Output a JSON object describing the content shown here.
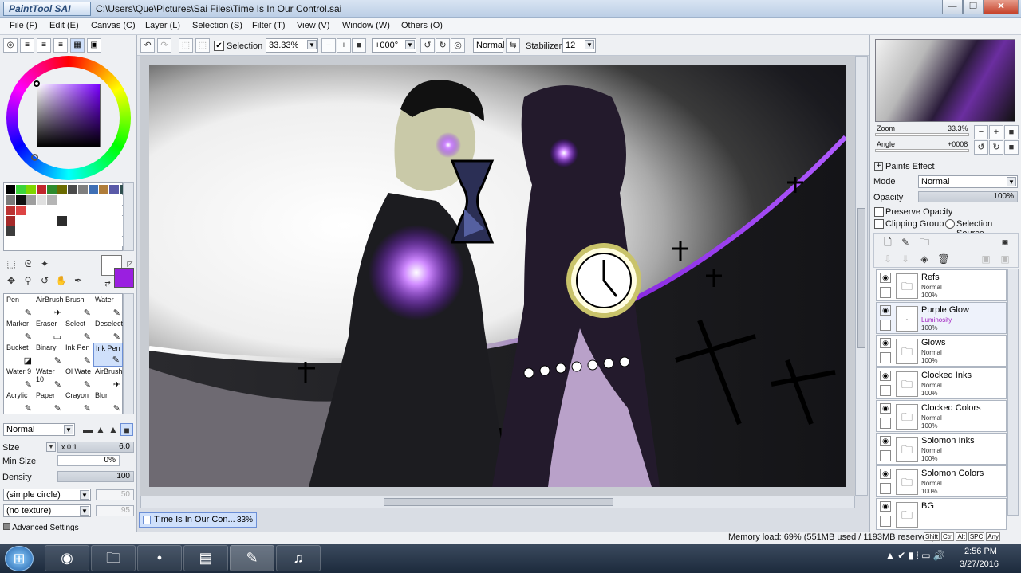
{
  "window": {
    "app_name": "PaintTool SAI",
    "title": "C:\\Users\\Que\\Pictures\\Sai Files\\Time Is In Our Control.sai",
    "controls": [
      "—",
      "❐",
      "✕"
    ]
  },
  "menu": [
    "File (F)",
    "Edit (E)",
    "Canvas (C)",
    "Layer (L)",
    "Selection (S)",
    "Filter (T)",
    "View (V)",
    "Window (W)",
    "Others (O)"
  ],
  "color_panel": {
    "foreground": "#ffffff",
    "background": "#9a1fe0",
    "hue_accent": "#7a00ff"
  },
  "swatches": [
    "#000",
    "#3bd43b",
    "#7fd600",
    "#c1272d",
    "#2e8b2e",
    "#6b6b00",
    "#4a4a4a",
    "#7f7f7f",
    "#3f6fb5",
    "#b07d3a",
    "#5a5aa8",
    "#2f4f4f",
    "#7a7a7a",
    "#111",
    "#9e9e9e",
    "#e0e0e0",
    "#b5b5b5",
    "#ffffff",
    "#ffffff",
    "#ffffff",
    "#ffffff",
    "#ffffff",
    "#ffffff",
    "#ffffff",
    "#b33",
    "#dd4444",
    "#ffffff",
    "#ffffff",
    "#ffffff",
    "#ffffff",
    "#ffffff",
    "#ffffff",
    "#ffffff",
    "#ffffff",
    "#ffffff",
    "#ffffff",
    "#a52a2a",
    "#ffffff",
    "#ffffff",
    "#ffffff",
    "#ffffff",
    "#2d2d2d",
    "#ffffff",
    "#ffffff",
    "#ffffff",
    "#ffffff",
    "#ffffff",
    "#ffffff",
    "#3d3d3d",
    "#ffffff",
    "#ffffff",
    "#ffffff",
    "#ffffff",
    "#ffffff",
    "#ffffff",
    "#ffffff",
    "#ffffff",
    "#ffffff",
    "#ffffff",
    "#ffffff",
    "#ffffff",
    "#ffffff",
    "#ffffff",
    "#ffffff",
    "#ffffff",
    "#ffffff",
    "#ffffff",
    "#ffffff",
    "#ffffff",
    "#ffffff",
    "#ffffff",
    "#ffffff"
  ],
  "brushes": [
    {
      "name": "Pen",
      "icon": "✎"
    },
    {
      "name": "AirBrush",
      "icon": "✈"
    },
    {
      "name": "Brush",
      "icon": "✎"
    },
    {
      "name": "Water",
      "icon": "✎"
    },
    {
      "name": "Marker",
      "icon": "✎"
    },
    {
      "name": "Eraser",
      "icon": "▭"
    },
    {
      "name": "Select",
      "icon": "✎"
    },
    {
      "name": "Deselect",
      "icon": "✎"
    },
    {
      "name": "Bucket",
      "icon": "◪"
    },
    {
      "name": "Binary",
      "icon": "✎"
    },
    {
      "name": "Ink Pen",
      "icon": "✎"
    },
    {
      "name": "Ink Pen",
      "icon": "✎"
    },
    {
      "name": "Water 9",
      "icon": "✎"
    },
    {
      "name": "Water 10",
      "icon": "✎"
    },
    {
      "name": "Ol Wate",
      "icon": "✎"
    },
    {
      "name": "AirBrush",
      "icon": "✈"
    },
    {
      "name": "Acrylic",
      "icon": "✎"
    },
    {
      "name": "Paper",
      "icon": "✎"
    },
    {
      "name": "Crayon",
      "icon": "✎"
    },
    {
      "name": "Blur",
      "icon": "✎"
    }
  ],
  "brush_settings": {
    "blend_mode": "Normal",
    "size_label": "Size",
    "size_mult": "x 0.1",
    "size_value": "6.0",
    "min_size_label": "Min Size",
    "min_size_value": "0%",
    "density_label": "Density",
    "density_value": "100",
    "shape": "(simple circle)",
    "shape_value": "50",
    "texture": "(no texture)",
    "texture_value": "95",
    "advanced": "Advanced Settings"
  },
  "toolbar": {
    "selection_label": "Selection",
    "zoom": "33.33%",
    "angle": "+000°",
    "mode": "Normal",
    "stabilizer_label": "Stabilizer",
    "stabilizer": "12"
  },
  "document_tab": {
    "name": "Time Is In Our Con...",
    "zoom": "33%"
  },
  "navigator": {
    "zoom_label": "Zoom",
    "zoom_value": "33.3%",
    "angle_label": "Angle",
    "angle_value": "+0008"
  },
  "layer_props": {
    "paints_effect": "Paints Effect",
    "mode_label": "Mode",
    "mode_value": "Normal",
    "opacity_label": "Opacity",
    "opacity_value": "100%",
    "preserve_opacity": "Preserve Opacity",
    "clipping_group": "Clipping Group",
    "selection_source": "Selection Source"
  },
  "layers": [
    {
      "name": "Refs",
      "mode": "Normal",
      "opacity": "100%",
      "type": "folder"
    },
    {
      "name": "Purple Glow",
      "mode": "Luminosity",
      "opacity": "100%",
      "type": "layer"
    },
    {
      "name": "Glows",
      "mode": "Normal",
      "opacity": "100%",
      "type": "folder"
    },
    {
      "name": "Clocked Inks",
      "mode": "Normal",
      "opacity": "100%",
      "type": "folder"
    },
    {
      "name": "Clocked Colors",
      "mode": "Normal",
      "opacity": "100%",
      "type": "folder"
    },
    {
      "name": "Solomon Inks",
      "mode": "Normal",
      "opacity": "100%",
      "type": "folder"
    },
    {
      "name": "Solomon Colors",
      "mode": "Normal",
      "opacity": "100%",
      "type": "folder"
    },
    {
      "name": "BG",
      "mode": "",
      "opacity": "",
      "type": "folder"
    }
  ],
  "status": {
    "memory": "Memory load: 69% (551MB used / 1193MB reserved)",
    "keys": [
      "Shift",
      "Ctrl",
      "Alt",
      "SPC",
      "Any"
    ]
  },
  "taskbar": {
    "time": "2:56 PM",
    "date": "3/27/2016"
  }
}
